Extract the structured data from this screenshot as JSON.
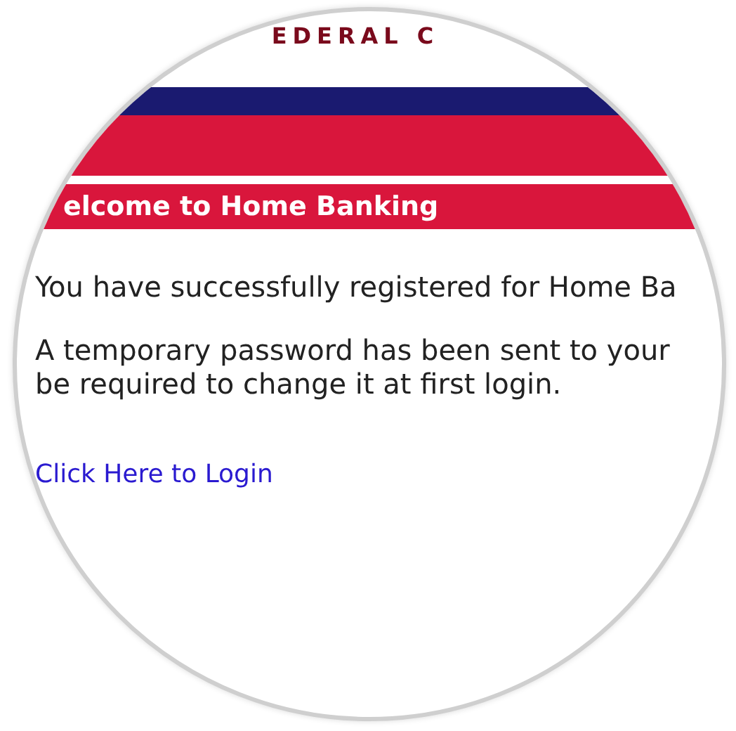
{
  "header": {
    "logo_text": "EDERAL C"
  },
  "welcome_bar": {
    "title": "elcome to Home Banking"
  },
  "paragraphs": [
    "You have successfully registered for Home Ba",
    "A temporary password has been sent to your\nbe required to change it at first login."
  ],
  "login_link": "Click Here to Login"
}
